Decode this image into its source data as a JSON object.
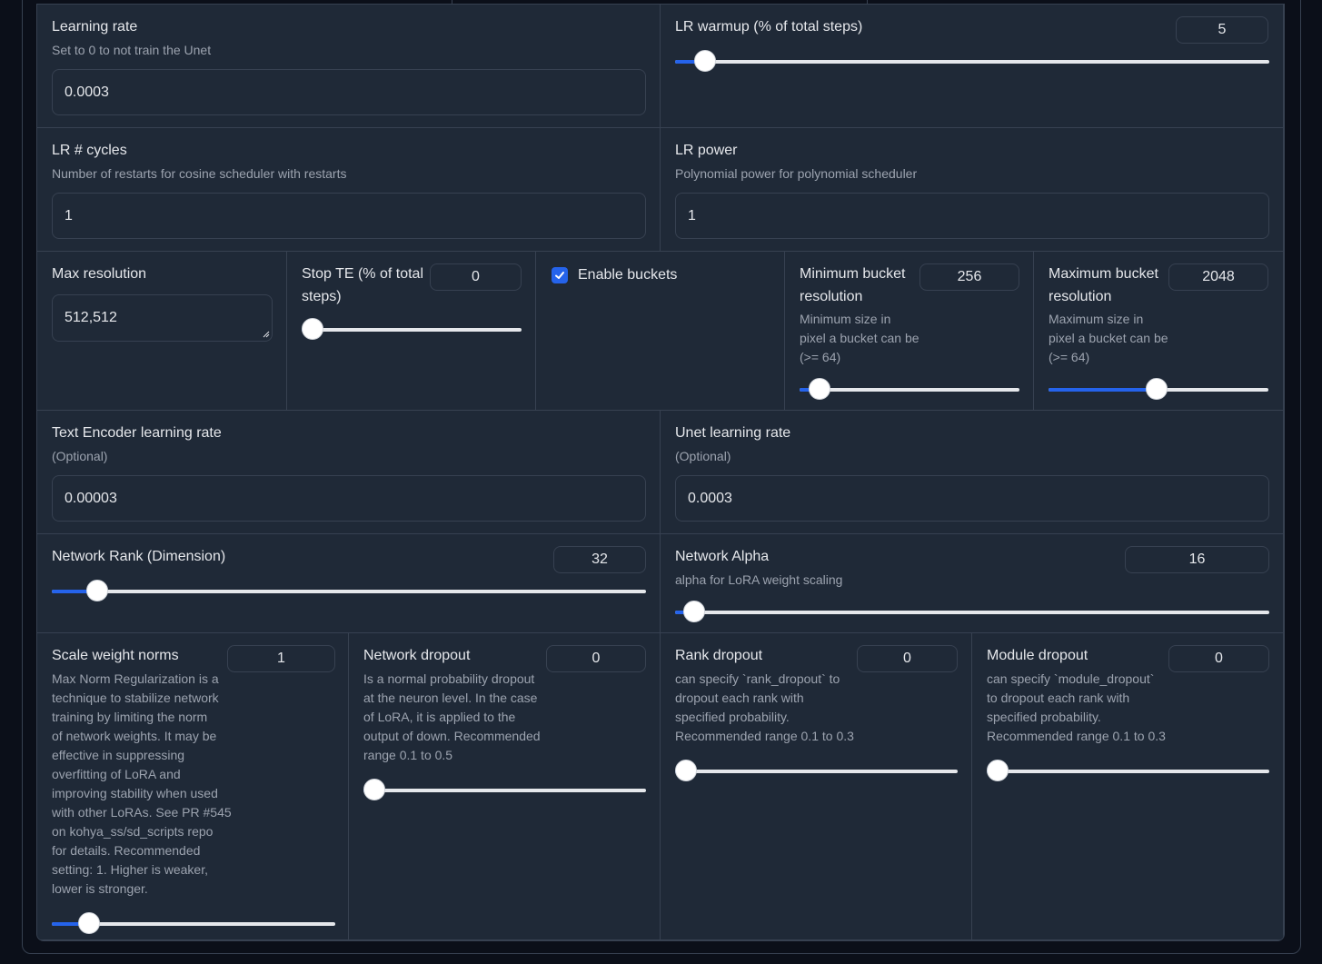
{
  "learning_rate": {
    "label": "Learning rate",
    "info": "Set to 0 to not train the Unet",
    "value": "0.0003"
  },
  "lr_warmup": {
    "label": "LR warmup (% of total steps)",
    "value": "5",
    "slider_fraction": 0.05
  },
  "lr_cycles": {
    "label": "LR # cycles",
    "info": "Number of restarts for cosine scheduler with restarts",
    "value": "1"
  },
  "lr_power": {
    "label": "LR power",
    "info": "Polynomial power for polynomial scheduler",
    "value": "1"
  },
  "max_resolution": {
    "label": "Max resolution",
    "value": "512,512"
  },
  "stop_te": {
    "label_line1": "Stop TE (% of total",
    "label_line2": "steps)",
    "value": "0",
    "slider_fraction": 0
  },
  "enable_buckets": {
    "label": "Enable buckets",
    "checked": true
  },
  "min_bucket": {
    "label_line1": "Minimum bucket",
    "label_line2": "resolution",
    "info": [
      "Minimum size in",
      "pixel a bucket can be",
      "(>= 64)"
    ],
    "value": "256",
    "slider_fraction": 0.09
  },
  "max_bucket": {
    "label_line1": "Maximum bucket",
    "label_line2": "resolution",
    "info": [
      "Maximum size in",
      "pixel a bucket can be",
      "(>= 64)"
    ],
    "value": "2048",
    "slider_fraction": 0.49
  },
  "te_lr": {
    "label": "Text Encoder learning rate",
    "info": "(Optional)",
    "value": "0.00003"
  },
  "unet_lr": {
    "label": "Unet learning rate",
    "info": "(Optional)",
    "value": "0.0003"
  },
  "network_rank": {
    "label": "Network Rank (Dimension)",
    "value": "32",
    "slider_fraction": 0.077
  },
  "network_alpha": {
    "label": "Network Alpha",
    "info": "alpha for LoRA weight scaling",
    "value": "16",
    "slider_fraction": 0.032
  },
  "scale_weight_norms": {
    "label": "Scale weight norms",
    "value": "1",
    "slider_fraction": 0.13,
    "info": [
      "Max Norm Regularization is a",
      "technique to stabilize network",
      "training by limiting the norm",
      "of network weights. It may be",
      "effective in suppressing",
      "overfitting of LoRA and",
      "improving stability when used",
      "with other LoRAs. See PR #545",
      "on kohya_ss/sd_scripts repo",
      "for details. Recommended",
      "setting: 1. Higher is weaker,",
      "lower is stronger."
    ]
  },
  "network_dropout": {
    "label": "Network dropout",
    "value": "0",
    "slider_fraction": 0,
    "info": [
      "Is a normal probability dropout",
      "at the neuron level. In the case",
      "of LoRA, it is applied to the",
      "output of down. Recommended",
      "range 0.1 to 0.5"
    ]
  },
  "rank_dropout": {
    "label": "Rank dropout",
    "value": "0",
    "slider_fraction": 0,
    "info": [
      "can specify `rank_dropout` to",
      "dropout each rank with",
      "specified probability.",
      "Recommended range 0.1 to 0.3"
    ]
  },
  "module_dropout": {
    "label": "Module dropout",
    "value": "0",
    "slider_fraction": 0,
    "info": [
      "can specify `module_dropout`",
      "to dropout each rank with",
      "specified probability.",
      "Recommended range 0.1 to 0.3"
    ]
  },
  "colors": {
    "background": "#0b0f19",
    "panel": "#1f2937",
    "border": "#374151",
    "accent": "#2563eb",
    "text": "#e5e7eb",
    "muted": "#9ca3af"
  }
}
